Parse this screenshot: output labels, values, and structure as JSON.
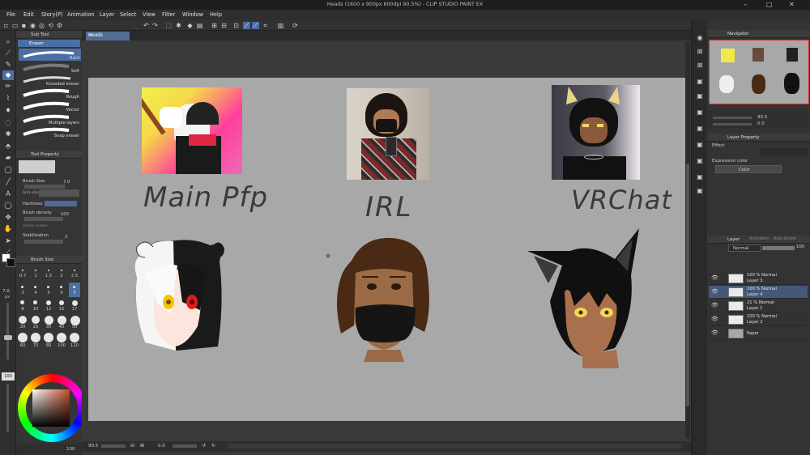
{
  "window": {
    "title": "Heads (1600 x 900px 600dpi 90.5%) - CLIP STUDIO PAINT EX"
  },
  "menu": [
    "File",
    "Edit",
    "Story(P)",
    "Animation",
    "Layer",
    "Select",
    "View",
    "Filter",
    "Window",
    "Help"
  ],
  "document_tab": "Heads",
  "sub_tool": {
    "panel_title": "Sub Tool",
    "group": "Eraser",
    "brushes": [
      "Hard",
      "Soft",
      "Kneaded eraser",
      "Rough",
      "Vector",
      "Multiple layers",
      "Snap eraser"
    ]
  },
  "tool_property": {
    "panel_title": "Tool Property",
    "brush_size_label": "Brush Size",
    "brush_size_value": "7.0",
    "anti_alias_label": "Anti-alias",
    "hardness_label": "Hardness",
    "brush_density_label": "Brush density",
    "brush_density_value": "100",
    "vector_eraser_label": "Vector eraser",
    "stabilization_label": "Stabilization",
    "stabilization_value": "2"
  },
  "brush_size_panel": {
    "panel_title": "Brush Size",
    "sizes": [
      "0.7",
      "1",
      "1.5",
      "2",
      "2.5",
      "3",
      "4",
      "5",
      "6",
      "7",
      "8",
      "10",
      "12",
      "15",
      "17",
      "20",
      "25",
      "30",
      "40",
      "50",
      "60",
      "70",
      "80",
      "100",
      "120"
    ]
  },
  "brush_size_slider": {
    "value": "7.0",
    "unit": "px"
  },
  "opacity_slider": {
    "value": "100"
  },
  "status": {
    "zoom": "90.5",
    "rotation": "0.0",
    "bottom_left_value": "100"
  },
  "canvas_captions": [
    "Main Pfp",
    "IRL",
    "VRChat"
  ],
  "navigator": {
    "panel_title": "Navigator",
    "zoom": "90.5",
    "angle": "0.0"
  },
  "layer_property": {
    "panel_title": "Layer Property",
    "effect_label": "Effect",
    "expression_color_label": "Expression color",
    "color_value": "Color"
  },
  "layer_panel": {
    "panel_title": "Layer",
    "tab2": "Animation",
    "tab3": "Auto Action",
    "blend_mode": "Normal",
    "opacity": "100",
    "layers": [
      {
        "line1": "100 % Normal",
        "line2": "Layer 3"
      },
      {
        "line1": "100 % Normal",
        "line2": "Layer 4"
      },
      {
        "line1": "21 % Normal",
        "line2": "Layer 1"
      },
      {
        "line1": "100 % Normal",
        "line2": "Layer 2"
      },
      {
        "line1": "",
        "line2": "Paper"
      }
    ]
  },
  "colors": {
    "accent": "#4a6fa5",
    "canvas": "#a8a8a8",
    "selected_layer": "#45587a"
  }
}
